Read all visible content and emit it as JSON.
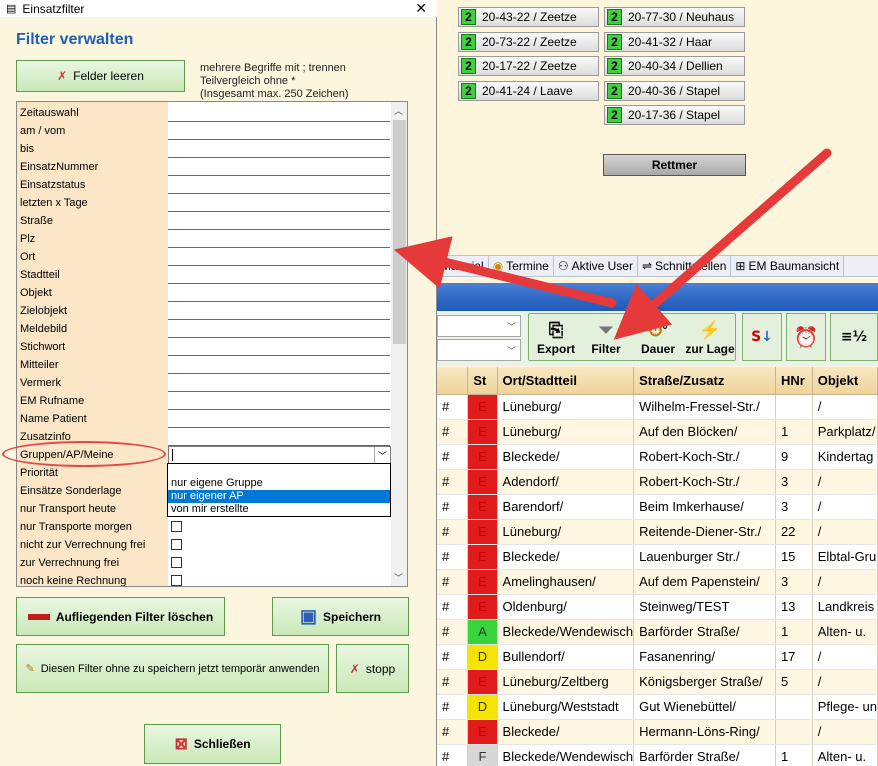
{
  "dialog": {
    "window_title": "Einsatzfilter",
    "heading": "Filter verwalten",
    "clear_button": "Felder leeren",
    "hint_lines": [
      "mehrere Begriffe mit ; trennen",
      "Teilvergleich ohne *",
      "(Insgesamt max. 250 Zeichen)"
    ],
    "fields": [
      "Zeitauswahl",
      "am / vom",
      "bis",
      "EinsatzNummer",
      "Einsatzstatus",
      "letzten x Tage",
      "Straße",
      "Plz",
      "Ort",
      "Stadtteil",
      "Objekt",
      "Zielobjekt",
      "Meldebild",
      "Stichwort",
      "Mitteiler",
      "Vermerk",
      "EM Rufname",
      "Name Patient",
      "Zusatzinfo",
      "Gruppen/AP/Meine",
      "Priorität",
      "Einsätze Sonderlage",
      "nur Transport heute",
      "nur Transporte morgen",
      "nicht zur Verrechnung frei",
      "zur Verrechnung frei",
      "noch keine Rechnung"
    ],
    "dropdown_options": [
      "nur eigene Gruppe",
      "nur eigener AP",
      "von mir erstellte"
    ],
    "dropdown_selected_index": 1,
    "delete_filter_button": "Aufliegenden Filter löschen",
    "save_button": "Speichern",
    "apply_temp_button": "Diesen Filter ohne zu speichern jetzt temporär anwenden",
    "stop_button": "stopp",
    "close_button": "Schließen"
  },
  "vehicles": {
    "badge": "2",
    "col1": [
      "20-43-22 / Zeetze",
      "20-73-22 / Zeetze",
      "20-17-22 / Zeetze",
      "20-41-24 / Laave"
    ],
    "col2": [
      "20-77-30 / Neuhaus",
      "20-41-32 / Haar",
      "20-40-34 / Dellien",
      "20-40-36 / Stapel",
      "20-17-36 / Stapel"
    ],
    "group_button": "Rettmer"
  },
  "tabs": [
    "Material",
    "Termine",
    "Aktive User",
    "Schnittstellen",
    "EM Baumansicht"
  ],
  "toolbar": {
    "export": "Export",
    "filter": "Filter",
    "dauer": "Dauer",
    "dauer_badge": "0",
    "zur_lage": "zur Lage"
  },
  "table": {
    "headers": [
      "St",
      "Ort/Stadtteil",
      "Straße/Zusatz",
      "HNr",
      "Objekt"
    ],
    "rows": [
      {
        "mark": "#",
        "st": "E",
        "ort": "Lüneburg/",
        "str": "Wilhelm-Fressel-Str./",
        "hnr": "",
        "obj": "/"
      },
      {
        "mark": "#",
        "st": "E",
        "ort": "Lüneburg/",
        "str": "Auf den Blöcken/",
        "hnr": "1",
        "obj": "Parkplatz/"
      },
      {
        "mark": "#",
        "st": "E",
        "ort": "Bleckede/",
        "str": "Robert-Koch-Str./",
        "hnr": "9",
        "obj": "Kindertag"
      },
      {
        "mark": "#",
        "st": "E",
        "ort": "Adendorf/",
        "str": "Robert-Koch-Str./",
        "hnr": "3",
        "obj": "/"
      },
      {
        "mark": "#",
        "st": "E",
        "ort": "Barendorf/",
        "str": "Beim Imkerhause/",
        "hnr": "3",
        "obj": "/"
      },
      {
        "mark": "#",
        "st": "E",
        "ort": "Lüneburg/",
        "str": "Reitende-Diener-Str./",
        "hnr": "22",
        "obj": "/"
      },
      {
        "mark": "#",
        "st": "E",
        "ort": "Bleckede/",
        "str": "Lauenburger Str./",
        "hnr": "15",
        "obj": "Elbtal-Gru"
      },
      {
        "mark": "#",
        "st": "E",
        "ort": "Amelinghausen/",
        "str": "Auf dem Papenstein/",
        "hnr": "3",
        "obj": "/"
      },
      {
        "mark": "#",
        "st": "E",
        "ort": "Oldenburg/",
        "str": "Steinweg/TEST",
        "hnr": "13",
        "obj": "Landkreis"
      },
      {
        "mark": "#",
        "st": "A",
        "ort": "Bleckede/Wendewisch",
        "str": "Barförder Straße/",
        "hnr": "1",
        "obj": "Alten- u."
      },
      {
        "mark": "#",
        "st": "D",
        "ort": "Bullendorf/",
        "str": "Fasanenring/",
        "hnr": "17",
        "obj": "/"
      },
      {
        "mark": "#",
        "st": "E",
        "ort": "Lüneburg/Zeltberg",
        "str": "Königsberger Straße/",
        "hnr": "5",
        "obj": "/"
      },
      {
        "mark": "#",
        "st": "D",
        "ort": "Lüneburg/Weststadt",
        "str": "Gut Wienebüttel/",
        "hnr": "",
        "obj": "Pflege- un"
      },
      {
        "mark": "#",
        "st": "E",
        "ort": "Bleckede/",
        "str": "Hermann-Löns-Ring/",
        "hnr": "",
        "obj": "/"
      },
      {
        "mark": "#",
        "st": "F",
        "ort": "Bleckede/Wendewisch",
        "str": "Barförder Straße/",
        "hnr": "1",
        "obj": "Alten- u."
      }
    ]
  },
  "colors": {
    "status_E": "#e11b1b",
    "status_A": "#39d33c",
    "status_D": "#f5e400",
    "status_F": "#d7d7d7",
    "annotation": "#e5393a",
    "heading": "#1e5fb8"
  }
}
